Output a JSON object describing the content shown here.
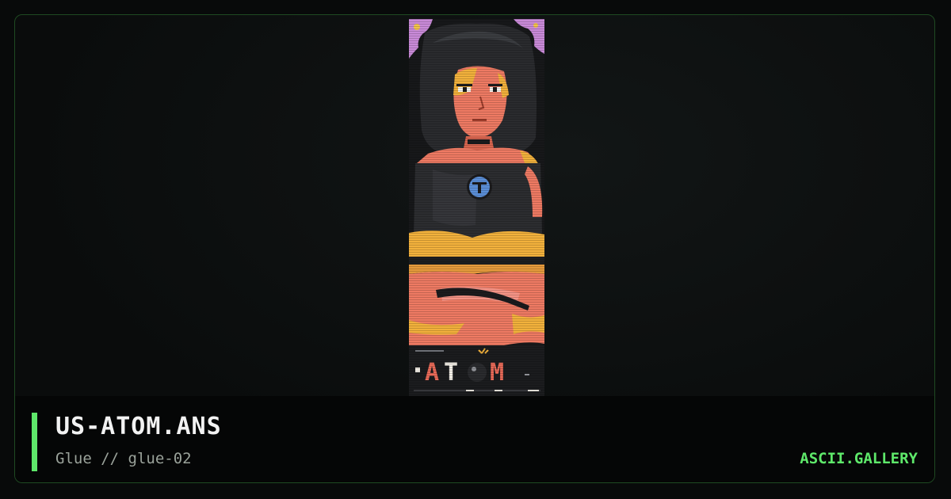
{
  "artwork": {
    "filename": "US-ATOM.ANS",
    "credit": "Glue // glue-02",
    "embedded_text": "ATOM"
  },
  "site": {
    "name": "ASCII.GALLERY"
  },
  "colors": {
    "accent": "#5ee86a",
    "background": "#080a0a",
    "border": "#1f4a22",
    "title": "#f2f2f2",
    "subtitle": "#9aa29a"
  }
}
